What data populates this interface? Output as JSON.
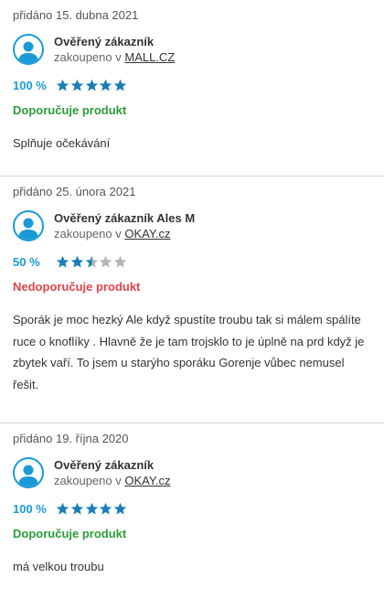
{
  "reviews": [
    {
      "date": "přidáno 15. dubna 2021",
      "author": "Ověřený zákazník",
      "bought_prefix": "zakoupeno v",
      "shop": "MALL.CZ",
      "percent": "100 %",
      "stars": 5,
      "verdict": "Doporučuje produkt",
      "verdict_type": "positive",
      "text": "Splňuje očekávání"
    },
    {
      "date": "přidáno 25. února 2021",
      "author": "Ověřený zákazník Ales M",
      "bought_prefix": "zakoupeno v",
      "shop": "OKAY.cz",
      "percent": "50 %",
      "stars": 2.5,
      "verdict": "Nedoporučuje produkt",
      "verdict_type": "negative",
      "text": "Sporák je moc hezký Ale když spustíte troubu tak si málem spálíte ruce o knoflíky . Hlavně že je tam trojsklo to je úplně na prd když je zbytek vaří. To jsem u starýho sporáku Gorenje vůbec nemusel řešit."
    },
    {
      "date": "přidáno 19. října 2020",
      "author": "Ověřený zákazník",
      "bought_prefix": "zakoupeno v",
      "shop": "OKAY.cz",
      "percent": "100 %",
      "stars": 5,
      "verdict": "Doporučuje produkt",
      "verdict_type": "positive",
      "text": "má velkou troubu"
    }
  ],
  "colors": {
    "accent": "#1a9bd7",
    "positive": "#2a9d3a",
    "negative": "#e0454c",
    "star_filled": "#1a7fb5",
    "star_empty": "#b5b5b5"
  },
  "icons": {
    "avatar": "user-avatar-icon",
    "star": "star-icon"
  }
}
